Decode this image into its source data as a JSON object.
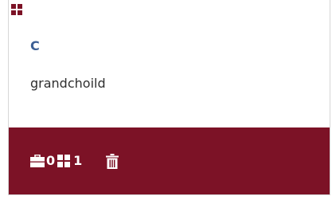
{
  "card": {
    "title": "C",
    "description": "grandchoild"
  },
  "footer": {
    "briefcase_count": "0",
    "grid_count": "1"
  },
  "icons": {
    "corner": "grid-icon",
    "briefcase": "briefcase-icon",
    "grid": "grid-icon",
    "delete": "trash-icon"
  },
  "colors": {
    "accent": "#7c1226",
    "title": "#3c5f94",
    "text": "#2f2f2f"
  }
}
